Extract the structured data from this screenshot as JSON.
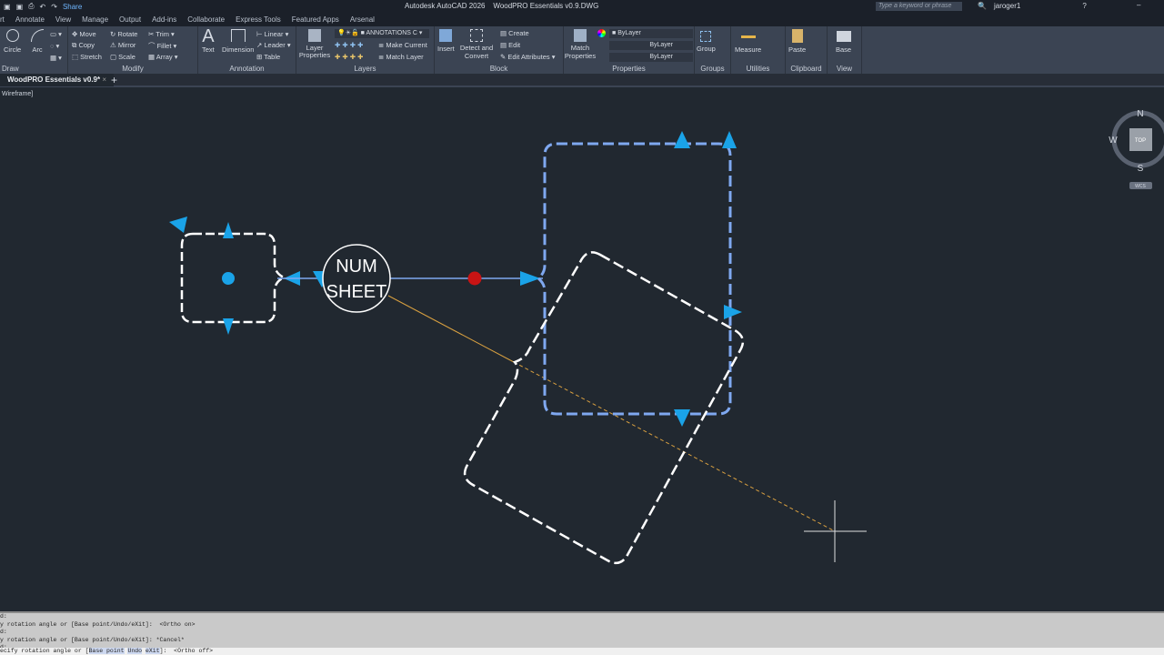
{
  "titlebar": {
    "share": "Share",
    "title": "Autodesk AutoCAD 2026",
    "file": "WoodPRO Essentials v0.9.DWG",
    "search_placeholder": "Type a keyword or phrase",
    "user": "jaroger1"
  },
  "menu_tabs": [
    "rt",
    "Annotate",
    "View",
    "Manage",
    "Output",
    "Add-ins",
    "Collaborate",
    "Express Tools",
    "Featured Apps",
    "Arsenal"
  ],
  "ribbon": {
    "draw": {
      "title": "Draw",
      "circle": "Circle",
      "arc": "Arc"
    },
    "modify": {
      "title": "Modify",
      "move": "Move",
      "rotate": "Rotate",
      "trim": "Trim",
      "copy": "Copy",
      "mirror": "Mirror",
      "fillet": "Fillet",
      "stretch": "Stretch",
      "scale": "Scale",
      "array": "Array"
    },
    "annotation": {
      "title": "Annotation",
      "text": "Text",
      "dimension": "Dimension",
      "linear": "Linear",
      "leader": "Leader",
      "table": "Table"
    },
    "layers": {
      "title": "Layers",
      "layer_properties": "Layer Properties",
      "current_layer": "ANNOTATIONS C",
      "make_current": "Make Current",
      "match_layer": "Match Layer"
    },
    "block": {
      "title": "Block",
      "insert": "Insert",
      "detect": "Detect and Convert",
      "create": "Create",
      "edit": "Edit",
      "edit_attributes": "Edit Attributes"
    },
    "properties": {
      "title": "Properties",
      "match": "Match Properties",
      "color": "ByLayer",
      "lineweight": "ByLayer",
      "linetype": "ByLayer"
    },
    "groups": {
      "title": "Groups",
      "group": "Group"
    },
    "utilities": {
      "title": "Utilities",
      "measure": "Measure"
    },
    "clipboard": {
      "title": "Clipboard",
      "paste": "Paste"
    },
    "view": {
      "title": "View",
      "base": "Base"
    }
  },
  "doc_tab": "WoodPRO Essentials v0.9*",
  "viewport": {
    "label": "Wireframe]",
    "compass": {
      "n": "N",
      "w": "W",
      "s": "S",
      "top": "TOP",
      "wcs": "WCS"
    }
  },
  "drawing": {
    "tag_line1": "NUM",
    "tag_line2": "SHEET"
  },
  "command": {
    "history": [
      "d:",
      "y rotation angle or [Base point/Undo/eXit]:  <Ortho on>",
      "d:",
      "y rotation angle or [Base point/Undo/eXit]: *Cancel*",
      "d:"
    ],
    "prompt_pre": "ecify rotation angle or [",
    "opt1": "Base point",
    "opt2": "Undo",
    "opt3": "eXit",
    "prompt_post": "]:  <Ortho off>"
  },
  "colors": {
    "grip": "#1aa3e8",
    "selection": "#7fa8f0",
    "hot_grip": "#c81414",
    "rubberband": "#d9a040"
  }
}
